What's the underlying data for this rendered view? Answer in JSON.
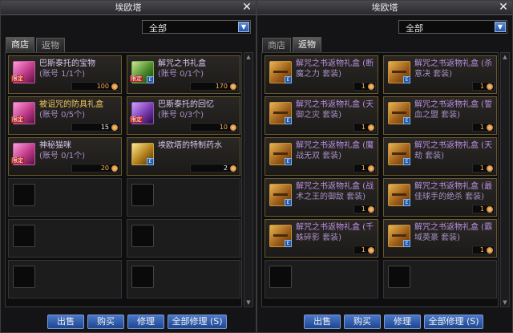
{
  "left": {
    "title": "埃欧塔",
    "close": "✕",
    "filter": "全部",
    "tabs": [
      "商店",
      "返物"
    ],
    "active_tab": 0,
    "slots": [
      {
        "name": "巴斯泰托的宝物",
        "sub": "(账号 1/1个)",
        "price": "100",
        "icon": "pink",
        "icon_name": "treasure-icon",
        "limited": true,
        "name_style": "white"
      },
      {
        "name": "解咒之书礼盒",
        "sub": "(账号 0/1个)",
        "price": "170",
        "icon": "green",
        "icon_name": "book-box-icon",
        "limited": true,
        "name_style": "white"
      },
      {
        "name": "被诅咒的防具礼盒",
        "sub": "(账号 0/5个)",
        "price": "15",
        "icon": "pink",
        "icon_name": "armor-box-icon",
        "limited": true,
        "name_style": "gold",
        "price_style": "white"
      },
      {
        "name": "巴斯泰托的回忆",
        "sub": "(账号 0/3个)",
        "price": "10",
        "icon": "violet",
        "icon_name": "memory-icon",
        "limited": true,
        "name_style": "white"
      },
      {
        "name": "神秘猫咪",
        "sub": "(账号 0/1个)",
        "price": "20",
        "icon": "pink",
        "icon_name": "cat-icon",
        "limited": true,
        "name_style": "white"
      },
      {
        "name": "埃欧塔的特制药水",
        "sub": "",
        "price": "2",
        "icon": "gold",
        "icon_name": "potion-icon",
        "limited": false,
        "name_style": "white",
        "price_style": "white"
      }
    ],
    "buttons": [
      "出售",
      "购买",
      "修理",
      "全部修理 (S)"
    ]
  },
  "right": {
    "title": "埃欧塔",
    "close": "✕",
    "filter": "全部",
    "tabs": [
      "商店",
      "返物"
    ],
    "active_tab": 1,
    "slots": [
      {
        "name": "解咒之书返物礼盒 (断",
        "sub": "魔之力 套装)",
        "price": "1"
      },
      {
        "name": "解咒之书返物礼盒 (杀",
        "sub": "意决 套装)",
        "price": "1"
      },
      {
        "name": "解咒之书返物礼盒 (天",
        "sub": "御之灾 套装)",
        "price": "1"
      },
      {
        "name": "解咒之书返物礼盒 (誓",
        "sub": "血之盟 套装)",
        "price": "1"
      },
      {
        "name": "解咒之书返物礼盒 (魔",
        "sub": "战无双 套装)",
        "price": "1"
      },
      {
        "name": "解咒之书返物礼盒 (天",
        "sub": "劫 套装)",
        "price": "1"
      },
      {
        "name": "解咒之书返物礼盒 (战",
        "sub": "术之王的御敌 套装)",
        "price": "1"
      },
      {
        "name": "解咒之书返物礼盒 (最",
        "sub": "佳球手的绝杀 套装)",
        "price": "1"
      },
      {
        "name": "解咒之书返物礼盒 (千",
        "sub": "蛛碎影 套装)",
        "price": "1"
      },
      {
        "name": "解咒之书返物礼盒 (霸",
        "sub": "域英豪 套装)",
        "price": "1"
      }
    ],
    "buttons": [
      "出售",
      "购买",
      "修理",
      "全部修理 (S)"
    ]
  }
}
